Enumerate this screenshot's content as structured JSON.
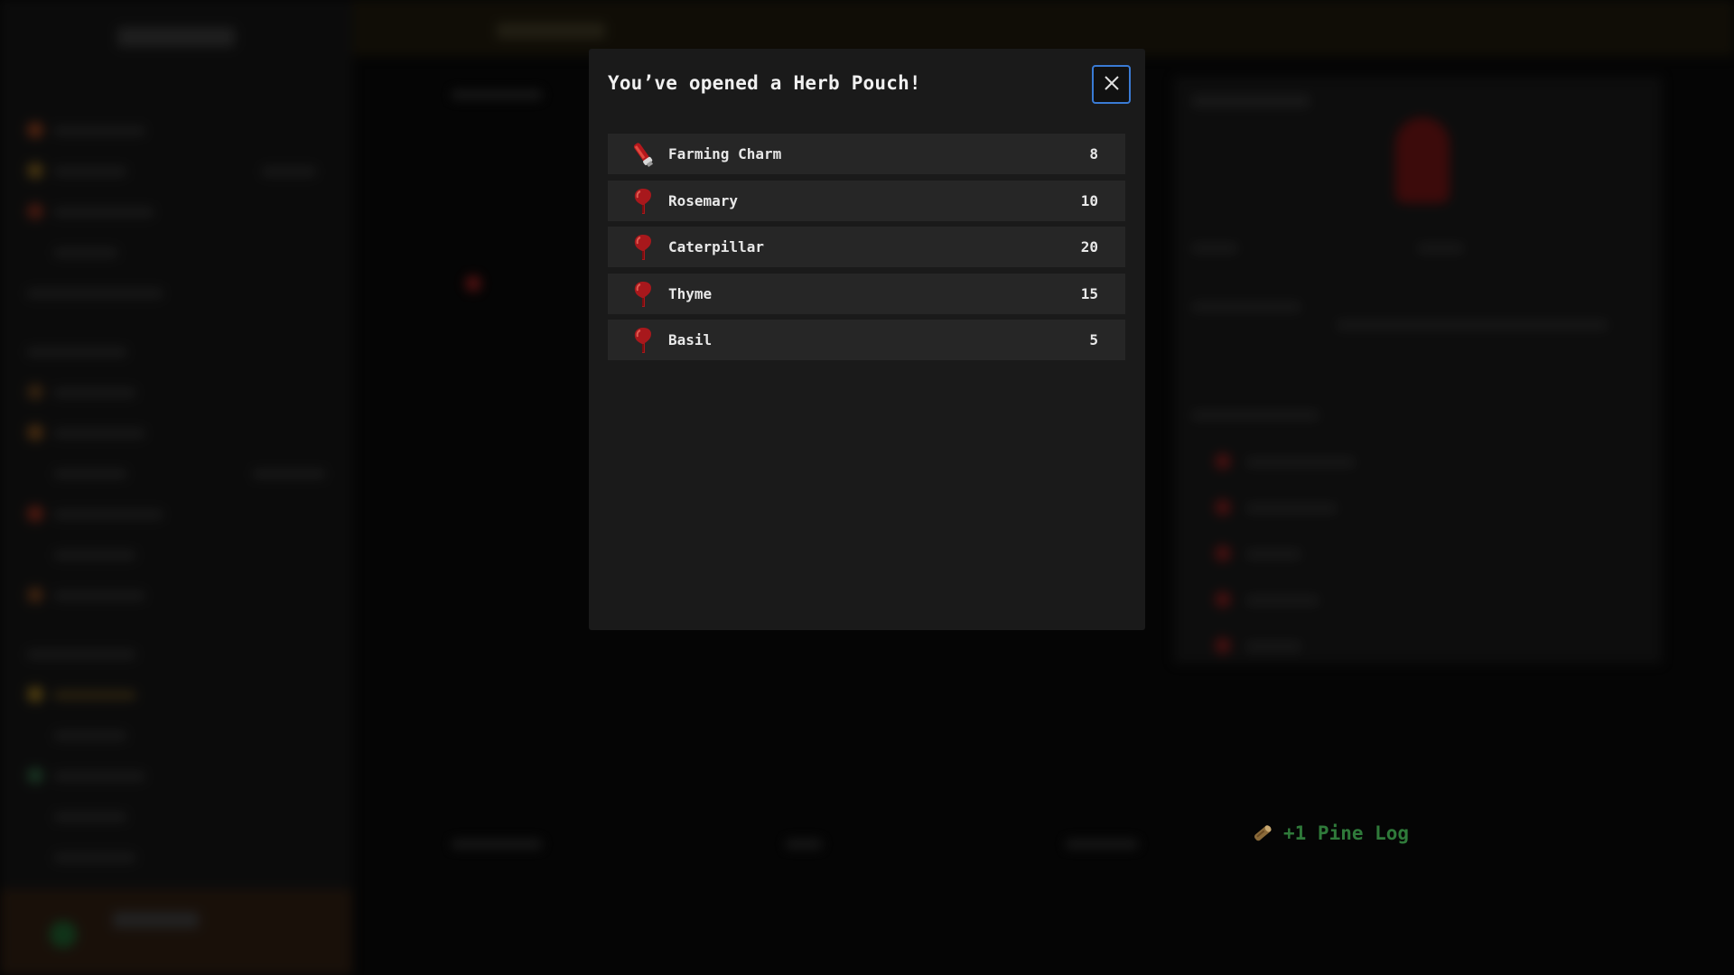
{
  "modal": {
    "title": "You’ve opened a Herb Pouch!",
    "close_icon": "close-icon",
    "items": [
      {
        "name": "Farming Charm",
        "quantity": "8",
        "icon": "charm-icon"
      },
      {
        "name": "Rosemary",
        "quantity": "10",
        "icon": "herb-icon"
      },
      {
        "name": "Caterpillar",
        "quantity": "20",
        "icon": "herb-icon"
      },
      {
        "name": "Thyme",
        "quantity": "15",
        "icon": "herb-icon"
      },
      {
        "name": "Basil",
        "quantity": "5",
        "icon": "herb-icon"
      }
    ]
  },
  "toast": {
    "text": "+1 Pine Log",
    "icon": "log-icon",
    "color": "#2f7a3a"
  },
  "colors": {
    "accent": "#3a7bd5",
    "herb": "#a8181c"
  }
}
